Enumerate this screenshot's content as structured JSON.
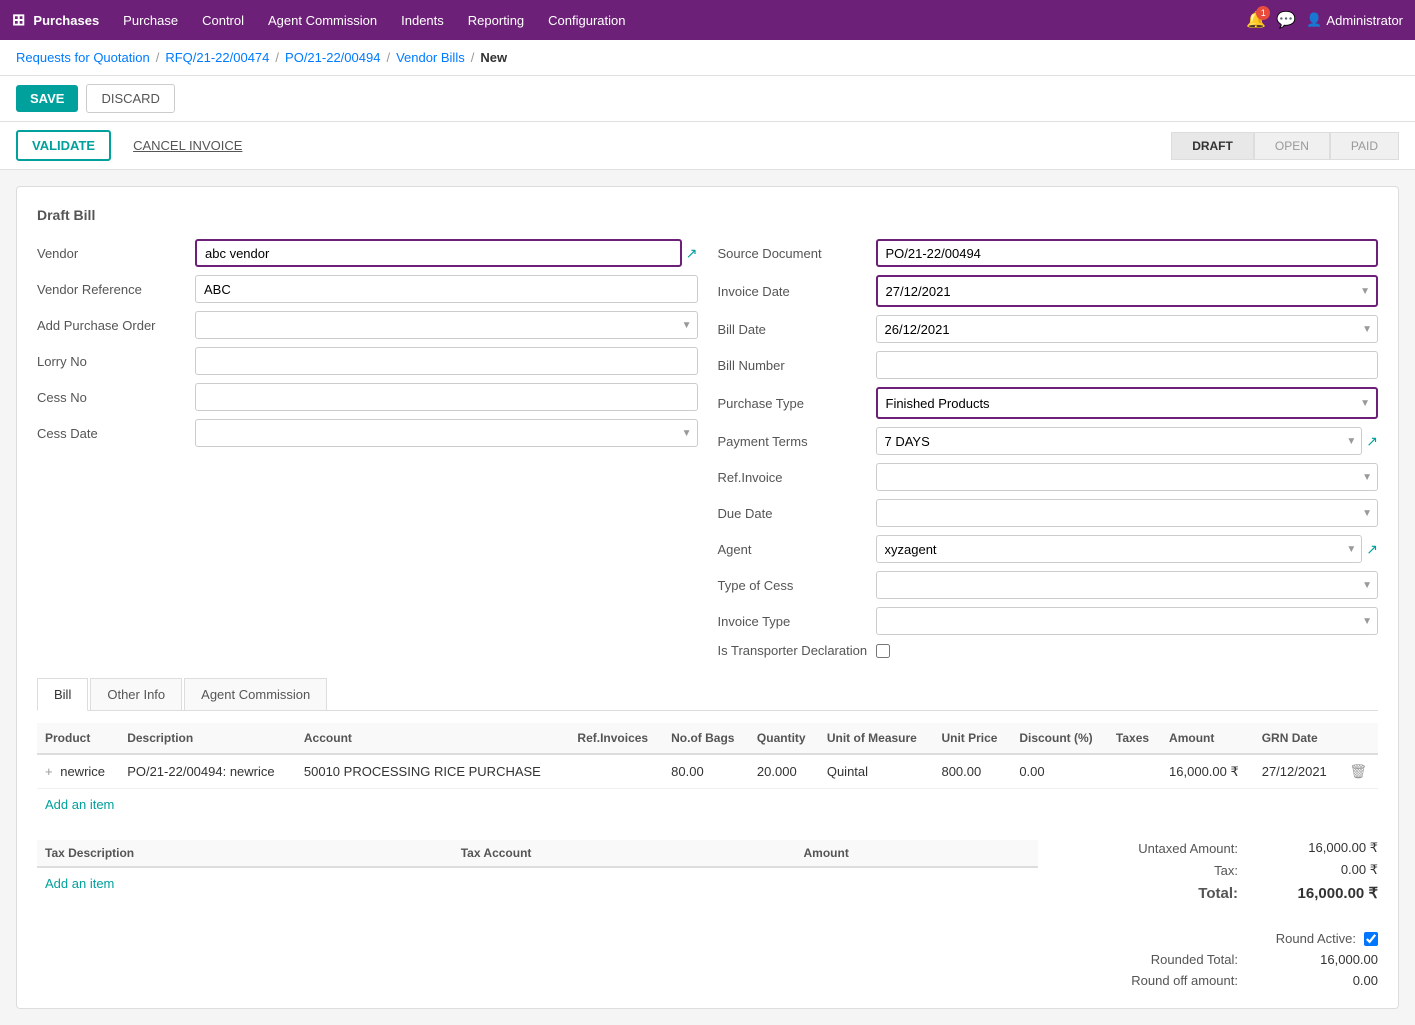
{
  "navbar": {
    "brand": "Purchases",
    "grid_icon": "⊞",
    "menu_items": [
      "Purchase",
      "Control",
      "Agent Commission",
      "Indents",
      "Reporting",
      "Configuration"
    ],
    "notification_count": "1",
    "user": "Administrator"
  },
  "breadcrumb": {
    "items": [
      {
        "label": "Requests for Quotation",
        "href": "#"
      },
      {
        "label": "RFQ/21-22/00474",
        "href": "#"
      },
      {
        "label": "PO/21-22/00494",
        "href": "#"
      },
      {
        "label": "Vendor Bills",
        "href": "#"
      },
      {
        "label": "New",
        "href": null
      }
    ]
  },
  "actions": {
    "save": "SAVE",
    "discard": "DISCARD",
    "validate": "VALIDATE",
    "cancel_invoice": "CANCEL INVOICE"
  },
  "status_steps": [
    "DRAFT",
    "OPEN",
    "PAID"
  ],
  "form": {
    "title": "Draft Bill",
    "left": {
      "vendor_label": "Vendor",
      "vendor_value": "abc vendor",
      "vendor_ref_label": "Vendor Reference",
      "vendor_ref_value": "ABC",
      "add_po_label": "Add Purchase Order",
      "lorry_no_label": "Lorry No",
      "cess_no_label": "Cess No",
      "cess_date_label": "Cess Date"
    },
    "right": {
      "source_doc_label": "Source Document",
      "source_doc_value": "PO/21-22/00494",
      "invoice_date_label": "Invoice Date",
      "invoice_date_value": "27/12/2021",
      "bill_date_label": "Bill Date",
      "bill_date_value": "26/12/2021",
      "bill_number_label": "Bill Number",
      "purchase_type_label": "Purchase Type",
      "purchase_type_value": "Finished Products",
      "payment_terms_label": "Payment Terms",
      "payment_terms_value": "7 DAYS",
      "ref_invoice_label": "Ref.Invoice",
      "due_date_label": "Due Date",
      "agent_label": "Agent",
      "agent_value": "xyzagent",
      "type_of_cess_label": "Type of Cess",
      "invoice_type_label": "Invoice Type",
      "is_transporter_label": "Is Transporter Declaration"
    }
  },
  "tabs": [
    {
      "label": "Bill",
      "active": true
    },
    {
      "label": "Other Info",
      "active": false
    },
    {
      "label": "Agent Commission",
      "active": false
    }
  ],
  "table": {
    "columns": [
      "Product",
      "Description",
      "Account",
      "Ref.Invoices",
      "No.of Bags",
      "Quantity",
      "Unit of Measure",
      "Unit Price",
      "Discount (%)",
      "Taxes",
      "Amount",
      "GRN Date"
    ],
    "rows": [
      {
        "product": "newrice",
        "description": "PO/21-22/00494: newrice",
        "account": "50010 PROCESSING RICE PURCHASE",
        "ref_invoices": "",
        "no_of_bags": "80.00",
        "quantity": "20.000",
        "unit_of_measure": "Quintal",
        "unit_price": "800.00",
        "discount": "0.00",
        "taxes": "",
        "amount": "16,000.00 ₹",
        "grn_date": "27/12/2021"
      }
    ],
    "add_item": "Add an item"
  },
  "tax_table": {
    "columns": [
      "Tax Description",
      "Tax Account",
      "Amount"
    ],
    "rows": [],
    "add_item": "Add an item"
  },
  "totals": {
    "untaxed_amount_label": "Untaxed Amount:",
    "untaxed_amount_value": "16,000.00 ₹",
    "tax_label": "Tax:",
    "tax_value": "0.00 ₹",
    "total_label": "Total:",
    "total_value": "16,000.00 ₹",
    "round_active_label": "Round Active:",
    "rounded_total_label": "Rounded Total:",
    "rounded_total_value": "16,000.00",
    "round_off_label": "Round off amount:",
    "round_off_value": "0.00"
  },
  "colors": {
    "primary": "#6d2077",
    "accent": "#00a09d",
    "border": "#ddd",
    "text_muted": "#555"
  }
}
